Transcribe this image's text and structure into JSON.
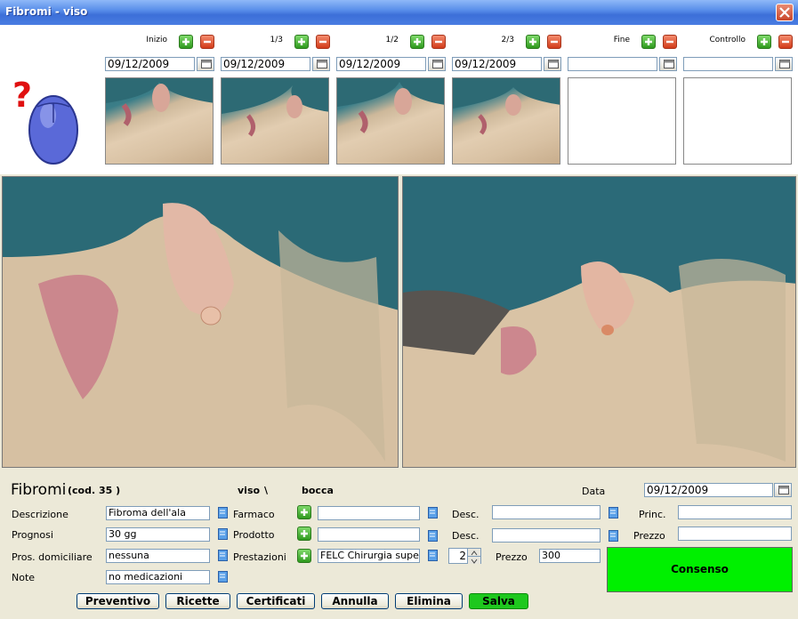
{
  "window": {
    "title": "Fibromi - viso"
  },
  "slots": [
    {
      "label": "Inizio",
      "date": "09/12/2009"
    },
    {
      "label": "1/3",
      "date": "09/12/2009"
    },
    {
      "label": "1/2",
      "date": "09/12/2009"
    },
    {
      "label": "2/3",
      "date": "09/12/2009"
    },
    {
      "label": "Fine",
      "date": ""
    },
    {
      "label": "Controllo",
      "date": ""
    }
  ],
  "header": {
    "title": "Fibromi",
    "code": "(cod.  35 )",
    "area": "viso",
    "separator": "\\",
    "zone": "bocca",
    "data_label": "Data",
    "date": "09/12/2009"
  },
  "form": {
    "descrizione_label": "Descrizione",
    "descrizione": "Fibroma dell'ala",
    "prognosi_label": "Prognosi",
    "prognosi": "30 gg",
    "pros_label": "Pros. domiciliare",
    "pros": "nessuna",
    "note_label": "Note",
    "note": "no medicazioni",
    "farmaco_label": "Farmaco",
    "farmaco": "",
    "prodotto_label": "Prodotto",
    "prodotto": "",
    "prestazioni_label": "Prestazioni",
    "prestazioni": "FELC Chirurgia supe",
    "desc1_label": "Desc.",
    "desc1": "",
    "desc2_label": "Desc.",
    "desc2": "",
    "princ_label": "Princ.",
    "princ": "",
    "prezzo_label": "Prezzo",
    "prezzo": "",
    "quantity": "2",
    "prezzo2_label": "Prezzo",
    "prezzo2": "300"
  },
  "buttons": {
    "preventivo": "Preventivo",
    "ricette": "Ricette",
    "certificati": "Certificati",
    "annulla": "Annulla",
    "elimina": "Elimina",
    "salva": "Salva",
    "consenso": "Consenso"
  },
  "colors": {
    "salva": "#1ec81e",
    "consenso": "#00f000",
    "title_bar": "#3C6FD8"
  }
}
